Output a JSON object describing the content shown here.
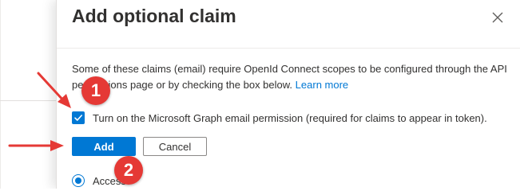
{
  "dialog": {
    "title": "Add optional claim",
    "body_text": "Some of these claims (email) require OpenId Connect scopes to be configured through the API permissions page or by checking the box below.",
    "learn_more_label": "Learn more",
    "checkbox_label": "Turn on the Microsoft Graph email permission (required for claims to appear in token).",
    "checkbox_checked": true,
    "add_label": "Add",
    "cancel_label": "Cancel",
    "radio_label": "Access",
    "radio_selected": true
  },
  "annotations": {
    "step1": "1",
    "step2": "2"
  },
  "colors": {
    "accent": "#0078d4",
    "annotation": "#e53935"
  },
  "icons": {
    "close": "close-icon",
    "check": "checkmark-icon",
    "arrow": "arrow-icon"
  }
}
